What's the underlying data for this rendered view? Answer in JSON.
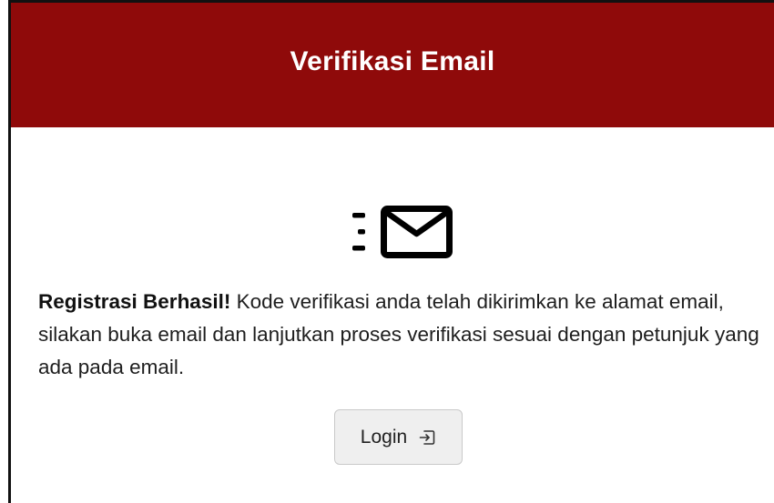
{
  "header": {
    "title": "Verifikasi Email"
  },
  "message": {
    "bold_prefix": "Registrasi Berhasil!",
    "text": " Kode verifikasi anda telah dikirimkan ke alamat email, silakan buka email dan lanjutkan proses verifikasi sesuai dengan petunjuk yang ada pada email."
  },
  "login_button": {
    "label": "Login",
    "icon": "login-icon"
  },
  "icons": {
    "mail": "mail-fast-icon"
  },
  "colors": {
    "header_bg": "#8f0a0a",
    "header_text": "#ffffff",
    "button_bg": "#efefef"
  }
}
